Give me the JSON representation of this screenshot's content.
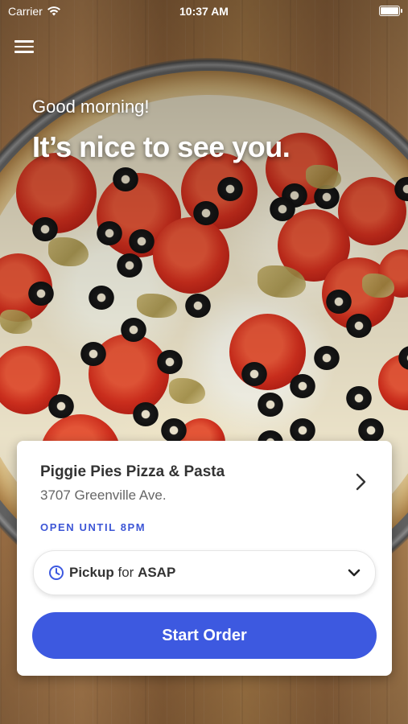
{
  "status_bar": {
    "carrier": "Carrier",
    "time": "10:37 AM"
  },
  "hero": {
    "greeting": "Good morning!",
    "headline": "It’s nice to see you."
  },
  "store": {
    "name": "Piggie Pies Pizza & Pasta",
    "address": "3707 Greenville Ave.",
    "hours": "OPEN UNTIL 8PM"
  },
  "order_mode": {
    "mode": "Pickup",
    "connector": "for",
    "time": "ASAP"
  },
  "actions": {
    "start_order": "Start Order"
  },
  "icons": {
    "menu": "hamburger-menu-icon",
    "wifi": "wifi-icon",
    "battery": "battery-icon",
    "store_chevron": "chevron-right-icon",
    "clock": "clock-icon",
    "dropdown": "chevron-down-icon"
  },
  "colors": {
    "accent": "#3d59e0",
    "hours_text": "#3d56d6",
    "card_bg": "#ffffff"
  }
}
